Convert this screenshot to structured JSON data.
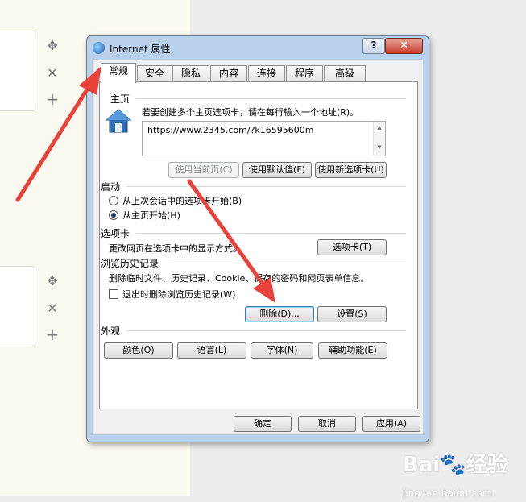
{
  "window": {
    "title": "Internet 属性",
    "help_label": "?",
    "close_label": "✕"
  },
  "tabs": [
    {
      "label": "常规",
      "active": true
    },
    {
      "label": "安全",
      "active": false
    },
    {
      "label": "隐私",
      "active": false
    },
    {
      "label": "内容",
      "active": false
    },
    {
      "label": "连接",
      "active": false
    },
    {
      "label": "程序",
      "active": false
    },
    {
      "label": "高级",
      "active": false
    }
  ],
  "homepage": {
    "header": "主页",
    "instruction": "若要创建多个主页选项卡，请在每行输入一个地址(R)。",
    "url_value": "https://www.2345.com/?k16595600m",
    "btn_current": "使用当前页(C)",
    "btn_default": "使用默认值(F)",
    "btn_newtab": "使用新选项卡(U)"
  },
  "startup": {
    "header": "启动",
    "option_last": "从上次会话中的选项卡开始(B)",
    "option_home": "从主页开始(H)",
    "selected": "从主页开始(H)"
  },
  "tabs_section": {
    "header": "选项卡",
    "description": "更改网页在选项卡中的显示方式。",
    "btn_tabs": "选项卡(T)"
  },
  "history": {
    "header": "浏览历史记录",
    "description": "删除临时文件、历史记录、Cookie、保存的密码和网页表单信息。",
    "checkbox_label": "退出时删除浏览历史记录(W)",
    "checkbox_checked": false,
    "btn_delete": "删除(D)...",
    "btn_settings": "设置(S)"
  },
  "appearance": {
    "header": "外观",
    "btn_colors": "颜色(O)",
    "btn_languages": "语言(L)",
    "btn_fonts": "字体(N)",
    "btn_accessibility": "辅助功能(E)"
  },
  "footer": {
    "ok": "确定",
    "cancel": "取消",
    "apply": "应用(A)"
  },
  "watermark": {
    "brand": "Bai",
    "suffix": "经验",
    "sub": "jingyan.baidu.com"
  },
  "side_icons": [
    "move-icon",
    "close-icon",
    "plus-icon",
    "move-icon",
    "close-icon",
    "plus-icon"
  ],
  "colors": {
    "arrow": "#e8433a",
    "titlebar": "#b9d1ea",
    "close": "#c53b2b"
  }
}
